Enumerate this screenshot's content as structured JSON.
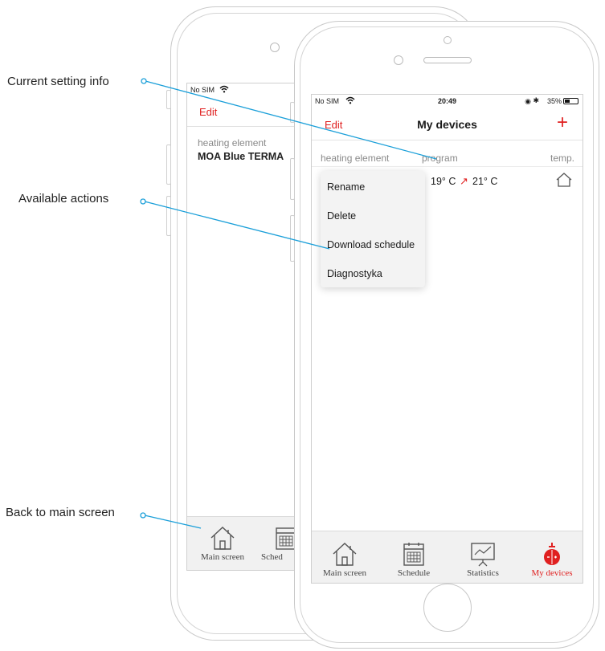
{
  "callouts": {
    "current_setting": "Current setting info",
    "available_actions": "Available actions",
    "back_to_main": "Back to main screen"
  },
  "back_phone": {
    "status_carrier": "No SIM",
    "edit_label": "Edit",
    "column_header": "heating element",
    "device_name": "MOA Blue TERMA",
    "tabs": [
      "Main screen",
      "Sched"
    ]
  },
  "front_phone": {
    "status": {
      "carrier": "No SIM",
      "time": "20:49",
      "battery": "35%"
    },
    "nav": {
      "edit_label": "Edit",
      "title": "My devices",
      "add_label": "+"
    },
    "columns": {
      "heating_element": "heating element",
      "program": "program",
      "temp": "temp."
    },
    "row": {
      "temp_from": "19° C",
      "arrow": "↗",
      "temp_to": "21° C"
    },
    "menu": [
      "Rename",
      "Delete",
      "Download schedule",
      "Diagnostyka"
    ],
    "tabs": [
      "Main screen",
      "Schedule",
      "Statistics",
      "My devices"
    ]
  },
  "colors": {
    "accent": "#e02020",
    "callout_line": "#1a9fd9"
  }
}
